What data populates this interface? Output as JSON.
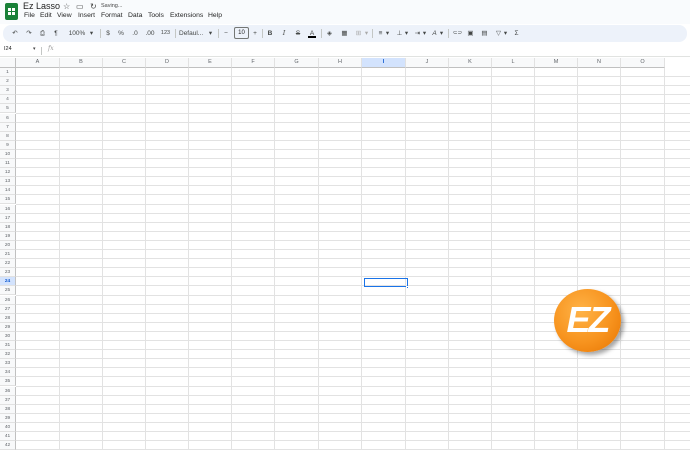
{
  "app": {
    "doc_title": "Ez Lasso",
    "saving_status": "Saving...",
    "accent_color": "#1a73e8",
    "brand_color": "#188038"
  },
  "menu": [
    "File",
    "Edit",
    "View",
    "Insert",
    "Format",
    "Data",
    "Tools",
    "Extensions",
    "Help"
  ],
  "toolbar": {
    "undo_icon": "↶",
    "redo_icon": "↷",
    "print_icon": "⎙",
    "paint_format_icon": "¶",
    "zoom": "100%",
    "currency": "$",
    "percent": "%",
    "decrease_decimal": ".0",
    "increase_decimal": ".00",
    "number_format": "123",
    "font": "Defaul...",
    "font_size": "10",
    "decrease_size": "−",
    "increase_size": "+",
    "bold": "B",
    "italic": "I",
    "strikethrough": "S",
    "text_color": "A",
    "fill_color_icon": "◈",
    "borders_icon": "▦",
    "merge_icon": "⊞",
    "halign_icon": "≡",
    "valign_icon": "⊥",
    "wrap_icon": "⇥",
    "rotate_icon": "A",
    "link_icon": "⊂⊃",
    "comment_icon": "▣",
    "chart_icon": "▤",
    "filter_icon": "▽",
    "functions_icon": "Σ",
    "dropdown_caret": "▾"
  },
  "formula_bar": {
    "name_box": "I24",
    "fx_label": "fx",
    "formula": ""
  },
  "columns": [
    "A",
    "B",
    "C",
    "D",
    "E",
    "F",
    "G",
    "H",
    "I",
    "J",
    "K",
    "L",
    "M",
    "N",
    "O"
  ],
  "rows": [
    "1",
    "2",
    "3",
    "4",
    "5",
    "6",
    "7",
    "8",
    "9",
    "10",
    "11",
    "12",
    "13",
    "14",
    "15",
    "16",
    "17",
    "18",
    "19",
    "20",
    "21",
    "22",
    "23",
    "24",
    "25",
    "26",
    "27",
    "28",
    "29",
    "30",
    "31",
    "32",
    "33",
    "34",
    "35",
    "36",
    "37",
    "38",
    "39",
    "40",
    "41",
    "42"
  ],
  "selected_column": "I",
  "selected_row": "24",
  "watermark": {
    "text": "EZ",
    "color": "#f7931e"
  }
}
